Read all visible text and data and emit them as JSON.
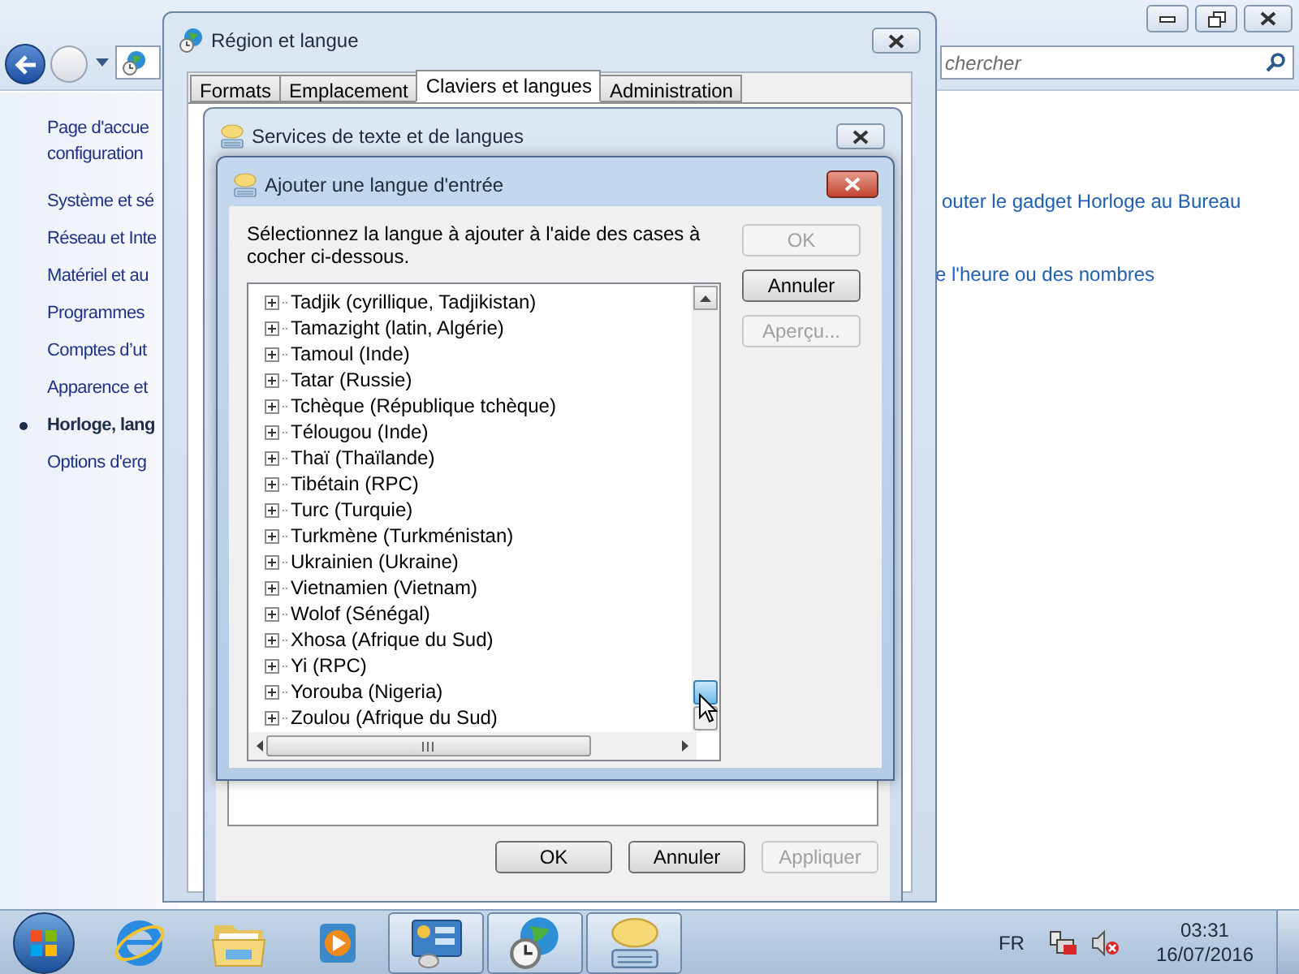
{
  "control_panel": {
    "search": {
      "placeholder": "chercher"
    },
    "home_link_lines": [
      "Page d'accue",
      "configuration"
    ],
    "sidebar": {
      "items": [
        {
          "label": "Système et sé",
          "selected": false
        },
        {
          "label": "Réseau et Inte",
          "selected": false
        },
        {
          "label": "Matériel et au",
          "selected": false
        },
        {
          "label": "Programmes",
          "selected": false
        },
        {
          "label": "Comptes d’ut",
          "selected": false
        },
        {
          "label": "Apparence et",
          "selected": false
        },
        {
          "label": "Horloge, lang",
          "selected": true
        },
        {
          "label": "Options d'erg",
          "selected": false
        }
      ]
    },
    "links": [
      "outer le gadget Horloge au Bureau",
      "e l'heure ou des nombres"
    ]
  },
  "region_window": {
    "title": "Région et langue",
    "tabs": [
      {
        "label": "Formats",
        "selected": false
      },
      {
        "label": "Emplacement",
        "selected": false
      },
      {
        "label": "Claviers et langues",
        "selected": true
      },
      {
        "label": "Administration",
        "selected": false
      }
    ]
  },
  "services_window": {
    "title": "Services de texte et de langues",
    "buttons": [
      {
        "label": "OK",
        "disabled": false
      },
      {
        "label": "Annuler",
        "disabled": false
      },
      {
        "label": "Appliquer",
        "disabled": true
      }
    ]
  },
  "add_window": {
    "title": "Ajouter une langue d'entrée",
    "instruction": "Sélectionnez la langue à ajouter à l'aide des cases à cocher ci-dessous.",
    "buttons": [
      {
        "label": "OK",
        "disabled": true
      },
      {
        "label": "Annuler",
        "disabled": false
      },
      {
        "label": "Aperçu...",
        "disabled": true
      }
    ],
    "languages": [
      {
        "label": "Tadjik (cyrillique, Tadjikistan)",
        "expanded": false
      },
      {
        "label": "Tamazight (latin, Algérie)",
        "expanded": false
      },
      {
        "label": "Tamoul (Inde)",
        "expanded": false
      },
      {
        "label": "Tatar (Russie)",
        "expanded": false
      },
      {
        "label": "Tchèque (République tchèque)",
        "expanded": false
      },
      {
        "label": "Télougou (Inde)",
        "expanded": false
      },
      {
        "label": "Thaï (Thaïlande)",
        "expanded": false
      },
      {
        "label": "Tibétain (RPC)",
        "expanded": false
      },
      {
        "label": "Turc (Turquie)",
        "expanded": false
      },
      {
        "label": "Turkmène (Turkménistan)",
        "expanded": false
      },
      {
        "label": "Ukrainien (Ukraine)",
        "expanded": false
      },
      {
        "label": "Vietnamien (Vietnam)",
        "expanded": false
      },
      {
        "label": "Wolof (Sénégal)",
        "expanded": false
      },
      {
        "label": "Xhosa (Afrique du Sud)",
        "expanded": false
      },
      {
        "label": "Yi (RPC)",
        "expanded": false
      },
      {
        "label": "Yorouba (Nigeria)",
        "expanded": false
      },
      {
        "label": "Zoulou (Afrique du Sud)",
        "expanded": false
      }
    ]
  },
  "taskbar": {
    "items": [
      {
        "kind": "browser",
        "running": false
      },
      {
        "kind": "folder",
        "running": false
      },
      {
        "kind": "media",
        "running": false
      },
      {
        "kind": "control",
        "running": true
      },
      {
        "kind": "region",
        "running": true
      },
      {
        "kind": "keyboard",
        "running": true
      }
    ],
    "language": "FR",
    "time": "03:31",
    "date": "16/07/2016"
  }
}
